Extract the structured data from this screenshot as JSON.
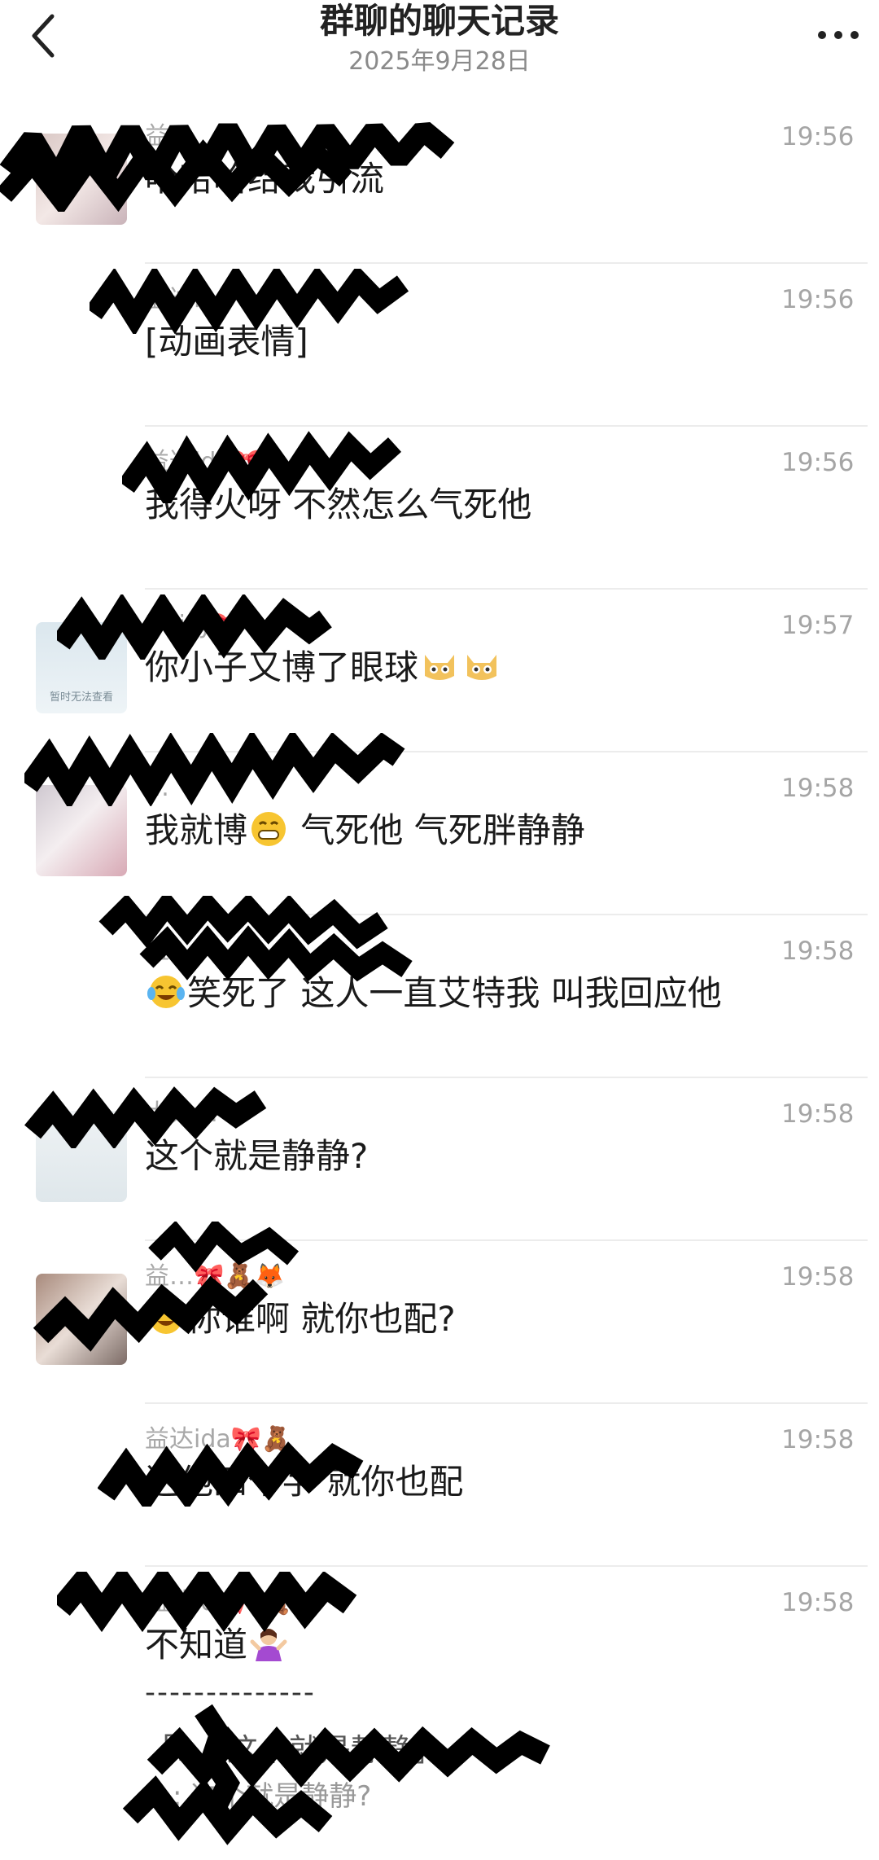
{
  "header": {
    "title": "群聊的聊天记录",
    "date": "2025年9月28日"
  },
  "messages": [
    {
      "name": "益…",
      "time": "19:56",
      "text": "哈哈哈给我引流"
    },
    {
      "name": "益达i…",
      "time": "19:56",
      "text": "[动画表情]"
    },
    {
      "name": "益达ida🎀",
      "time": "19:56",
      "text": "我得火呀 不然怎么气死他"
    },
    {
      "name": "Daisy🎀",
      "time": "19:57",
      "text": "你小子又博了眼球"
    },
    {
      "name": "…",
      "time": "19:58",
      "text_a": "我就博",
      "text_b": " 气死他 气死胖静静"
    },
    {
      "name": "益…",
      "time": "19:58",
      "text": "笑死了 这人一直艾特我 叫我回应他"
    },
    {
      "name": "大大…",
      "time": "19:58",
      "text": "这个就是静静?"
    },
    {
      "name": "益…🎀🧸🦊",
      "time": "19:58",
      "text": "你谁啊 就你也配?"
    },
    {
      "name": "益达ida🎀🧸",
      "time": "19:58",
      "text": "送他四个字 就你也配"
    },
    {
      "name": "益达ida🎀🧸",
      "time": "19:58",
      "text": "不知道",
      "dashes": "--------------",
      "quote": "「…: 这个就是静静」",
      "quote2": "…: 这个就是静静?"
    }
  ],
  "avatar_placeholder": "暂时无法查看",
  "colors": {
    "scribble": "#000000",
    "divider": "#ececec",
    "time": "#a5a5a5",
    "name": "#a8a8a8"
  }
}
